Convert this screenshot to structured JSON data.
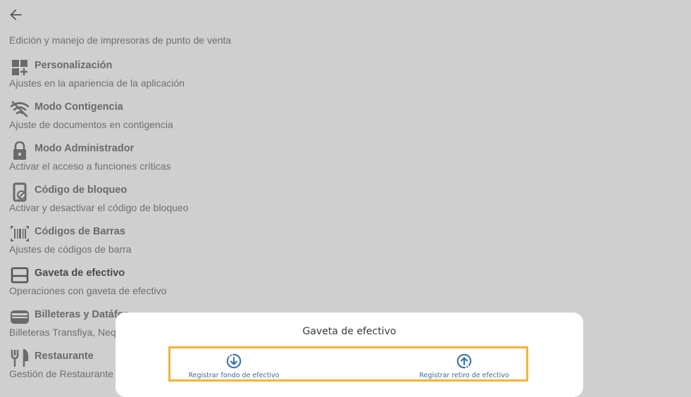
{
  "colors": {
    "background": "#cfcfcf",
    "text_muted": "#6f6f6f",
    "icon": "#6a6a6a",
    "sheet_bg": "#ffffff",
    "highlight": "#f2b43a",
    "action": "#3d6a99"
  },
  "header": {
    "back_icon": "arrow-left-icon",
    "subtitle": "Edición y manejo de impresoras de punto de venta"
  },
  "settings": {
    "items": [
      {
        "icon": "dashboard-add-icon",
        "title": "Personalización",
        "description": "Ajustes en la apariencia de la aplicación"
      },
      {
        "icon": "wifi-off-icon",
        "title": "Modo Contigencia",
        "description": "Ajuste de documentos en contigencia"
      },
      {
        "icon": "lock-icon",
        "title": "Modo Administrador",
        "description": "Activar el acceso a funciones críticas"
      },
      {
        "icon": "phone-lock-icon",
        "title": "Código de bloqueo",
        "description": "Activar y desactivar el código de bloqueo"
      },
      {
        "icon": "barcode-icon",
        "title": "Códigos de Barras",
        "description": "Ajustes de códigos de barra"
      },
      {
        "icon": "cash-drawer-icon",
        "title": "Gaveta de efectivo",
        "description": "Operaciones con gaveta de efectivo"
      },
      {
        "icon": "wallet-icon",
        "title": "Billeteras y Datáfor",
        "description": "Billeteras Transfiya, Neq"
      },
      {
        "icon": "restaurant-icon",
        "title": "Restaurante",
        "description": "Gestión de Restaurante"
      }
    ]
  },
  "sheet": {
    "title": "Gaveta de efectivo",
    "actions": [
      {
        "icon": "arrow-down-circle-icon",
        "label": "Registrar fondo de efectivo"
      },
      {
        "icon": "arrow-up-circle-icon",
        "label": "Registrar retiro de efectivo"
      }
    ]
  }
}
